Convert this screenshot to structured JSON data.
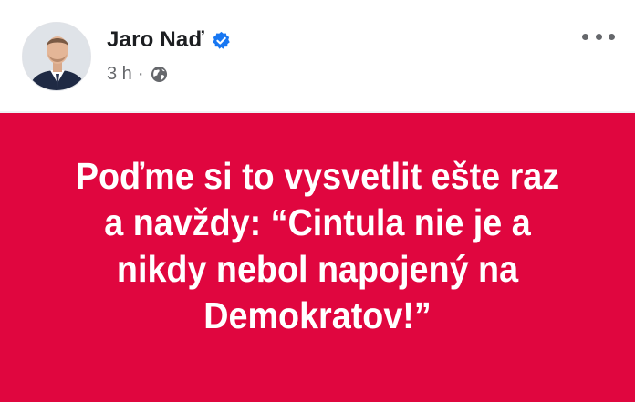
{
  "post": {
    "author_name": "Jaro Naď",
    "verified": true,
    "timestamp": "3 h",
    "separator": "·",
    "audience_icon": "globe-icon",
    "more_icon": "more-options-icon",
    "banner": {
      "text": "Poďme si to vysvetlit ešte raz a navždy: “Cintula nie je a nikdy nebol napojený na Demokratov!”",
      "background_color": "#e0063f",
      "text_color": "#ffffff"
    }
  },
  "colors": {
    "verified_badge": "#1877f2",
    "secondary_text": "#65676b",
    "primary_text": "#1c1e21"
  }
}
